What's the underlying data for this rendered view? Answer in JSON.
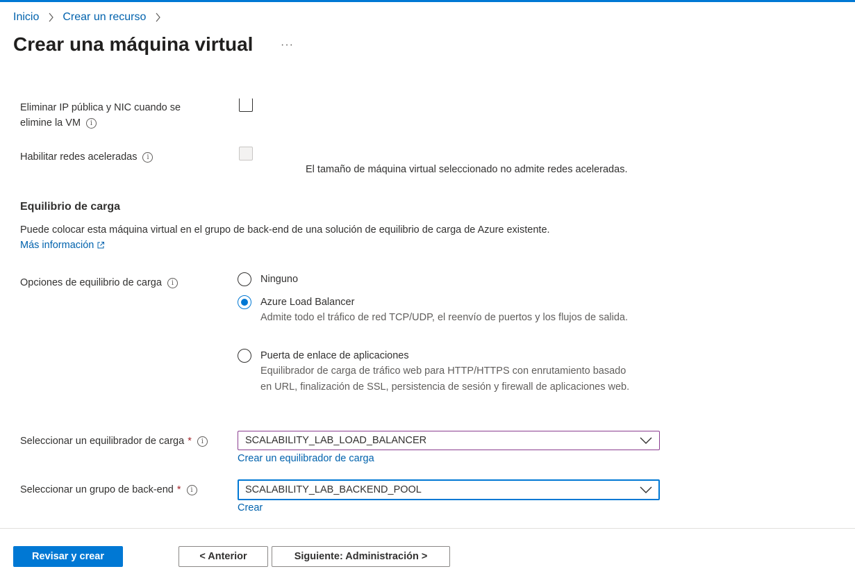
{
  "breadcrumb": {
    "home": "Inicio",
    "create_resource": "Crear un recurso"
  },
  "page_title": "Crear una máquina virtual",
  "more_label": "···",
  "fields": {
    "delete_ip_label_1": "Eliminar IP pública y NIC cuando se",
    "delete_ip_label_2": "elimine la VM",
    "delete_ip_checked": false,
    "accel_label": "Habilitar redes aceleradas",
    "accel_disabled": true,
    "accel_note": "El tamaño de máquina virtual seleccionado no admite redes aceleradas."
  },
  "load_balancing": {
    "section_title": "Equilibrio de carga",
    "description": "Puede colocar esta máquina virtual en el grupo de back-end de una solución de equilibrio de carga de Azure existente.",
    "more_info": "Más información",
    "options_label": "Opciones de equilibrio de carga",
    "options": [
      {
        "label": "Ninguno",
        "desc": "",
        "selected": false
      },
      {
        "label": "Azure Load Balancer",
        "desc": "Admite todo el tráfico de red TCP/UDP, el reenvío de puertos y los flujos de salida.",
        "selected": true
      },
      {
        "label": "Puerta de enlace de aplicaciones",
        "desc": "Equilibrador de carga de tráfico web para HTTP/HTTPS con enrutamiento basado en URL, finalización de SSL, persistencia de sesión y firewall de aplicaciones web.",
        "selected": false
      }
    ],
    "select_lb_label": "Seleccionar un equilibrador de carga",
    "select_lb_value": "SCALABILITY_LAB_LOAD_BALANCER",
    "create_lb_link": "Crear un equilibrador de carga",
    "select_pool_label": "Seleccionar un grupo de back-end",
    "select_pool_value": "SCALABILITY_LAB_BACKEND_POOL",
    "create_pool_link": "Crear",
    "required_mark": "*"
  },
  "footer": {
    "review_create": "Revisar y crear",
    "previous": "< Anterior",
    "next": "Siguiente: Administración >"
  },
  "colors": {
    "accent": "#0078d4",
    "link": "#0062ad",
    "focus_purple": "#8a3d8f",
    "required": "#a4262c"
  },
  "icons": [
    "chevron-right-icon",
    "info-icon",
    "external-link-icon",
    "chevron-down-icon"
  ]
}
